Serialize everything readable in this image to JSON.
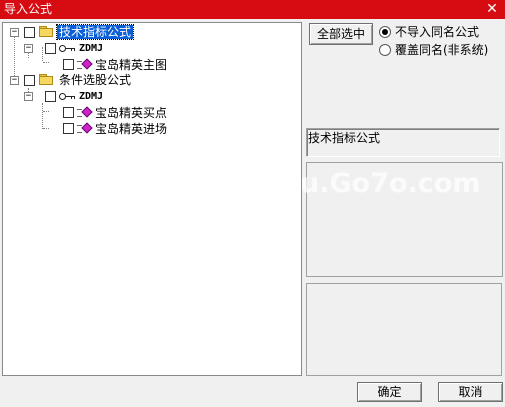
{
  "window": {
    "title": "导入公式",
    "close_glyph": "✕"
  },
  "tree": {
    "nodes": [
      {
        "expander": "−",
        "label": "技术指标公式",
        "type": "folder",
        "selected": true
      },
      {
        "expander": "−",
        "label": "ZDMJ",
        "type": "key"
      },
      {
        "label": "宝岛精英主图",
        "type": "formula"
      },
      {
        "expander": "−",
        "label": "条件选股公式",
        "type": "folder"
      },
      {
        "expander": "−",
        "label": "ZDMJ",
        "type": "key"
      },
      {
        "label": "宝岛精英买点",
        "type": "formula"
      },
      {
        "label": "宝岛精英进场",
        "type": "formula"
      }
    ]
  },
  "options": {
    "select_all_label": "全部选中",
    "radio_no_import": "不导入同名公式",
    "radio_overwrite": "覆盖同名(非系统)",
    "selected_radio": "no_import"
  },
  "info": {
    "category_text": "技术指标公式"
  },
  "footer": {
    "ok_label": "确定",
    "cancel_label": "取消"
  },
  "watermarks": {
    "center": "u.Go7o.com"
  }
}
